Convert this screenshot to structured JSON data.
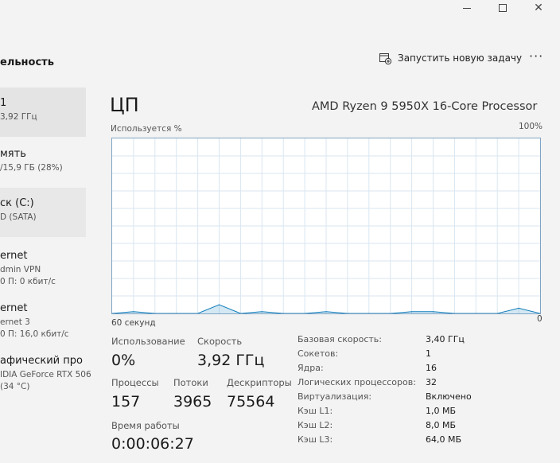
{
  "window": {
    "minimize_glyph": "",
    "close_glyph": "✕"
  },
  "cmdbar": {
    "page_heading": "ельность",
    "new_task_label": "Запустить новую задачу",
    "more_label": "···"
  },
  "sidebar": {
    "items": [
      {
        "title": "1",
        "subtitle": "3,92 ГГц"
      },
      {
        "title": "мять",
        "subtitle": "/15,9 ГБ (28%)"
      },
      {
        "title": "ск (C:)",
        "subtitle": "D (SATA)"
      },
      {
        "title": "ernet",
        "subtitle": "dmin VPN",
        "subtitle2": "0 П: 0 кбит/с"
      },
      {
        "title": "ernet",
        "subtitle": "ernet 3",
        "subtitle2": "0 П: 16,0 кбит/с"
      },
      {
        "title": "афический про",
        "subtitle": "IDIA GeForce RTX 506",
        "subtitle2": "(34 °C)"
      }
    ]
  },
  "main": {
    "title": "ЦП",
    "cpu_name": "AMD Ryzen 9 5950X 16-Core Processor",
    "usage_label": "Используется %",
    "max_label": "100%",
    "time_label": "60 секунд",
    "zero_label": "0"
  },
  "stats": {
    "usage_label": "Использование",
    "usage_value": "0%",
    "speed_label": "Скорость",
    "speed_value": "3,92 ГГц",
    "processes_label": "Процессы",
    "processes_value": "157",
    "threads_label": "Потоки",
    "threads_value": "3965",
    "handles_label": "Дескрипторы",
    "handles_value": "75564",
    "uptime_label": "Время работы",
    "uptime_value": "0:00:06:27"
  },
  "specs": [
    {
      "label": "Базовая скорость:",
      "value": "3,40 ГГц"
    },
    {
      "label": "Сокетов:",
      "value": "1"
    },
    {
      "label": "Ядра:",
      "value": "16"
    },
    {
      "label": "Логических процессоров:",
      "value": "32"
    },
    {
      "label": "Виртуализация:",
      "value": "Включено"
    },
    {
      "label": "Кэш L1:",
      "value": "1,0 МБ"
    },
    {
      "label": "Кэш L2:",
      "value": "8,0 МБ"
    },
    {
      "label": "Кэш L3:",
      "value": "64,0 МБ"
    }
  ],
  "chart_data": {
    "type": "area",
    "ylabel": "Используется %",
    "xlabel": "60 секунд",
    "ylim": [
      0,
      100
    ],
    "x": [
      60,
      57,
      54,
      51,
      48,
      45,
      42,
      39,
      36,
      33,
      30,
      27,
      24,
      21,
      18,
      15,
      12,
      9,
      6,
      3,
      0
    ],
    "values": [
      0,
      1,
      0,
      0,
      0,
      5,
      0,
      1,
      0,
      0,
      1,
      0,
      0,
      0,
      1,
      1,
      0,
      0,
      0,
      3,
      0
    ],
    "grid": true,
    "color": "#117dbb"
  }
}
